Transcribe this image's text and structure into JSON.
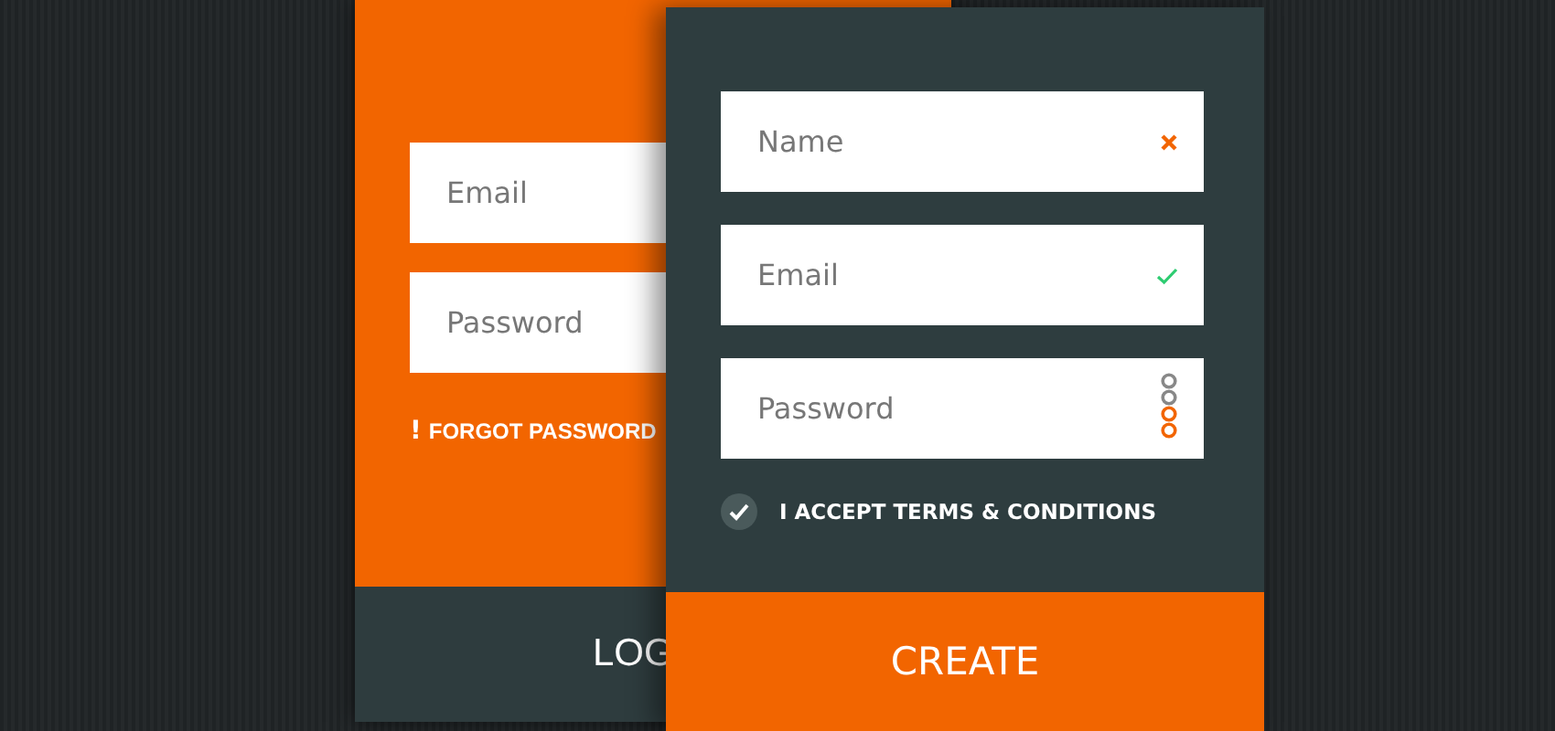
{
  "login": {
    "fields": [
      {
        "placeholder": "Email"
      },
      {
        "placeholder": "Password"
      }
    ],
    "forgot_link": "FORGOT PASSWORD",
    "forgot_icon": "!",
    "button": "LOG"
  },
  "register": {
    "fields": [
      {
        "placeholder": "Name",
        "kind": "status",
        "valid": false
      },
      {
        "placeholder": "Email",
        "kind": "status",
        "valid": true
      },
      {
        "placeholder": "Password",
        "kind": "strength",
        "level": 0.5
      }
    ],
    "terms": {
      "label": "I ACCEPT TERMS & CONDITIONS",
      "checked": true
    },
    "button": "CREATE"
  }
}
